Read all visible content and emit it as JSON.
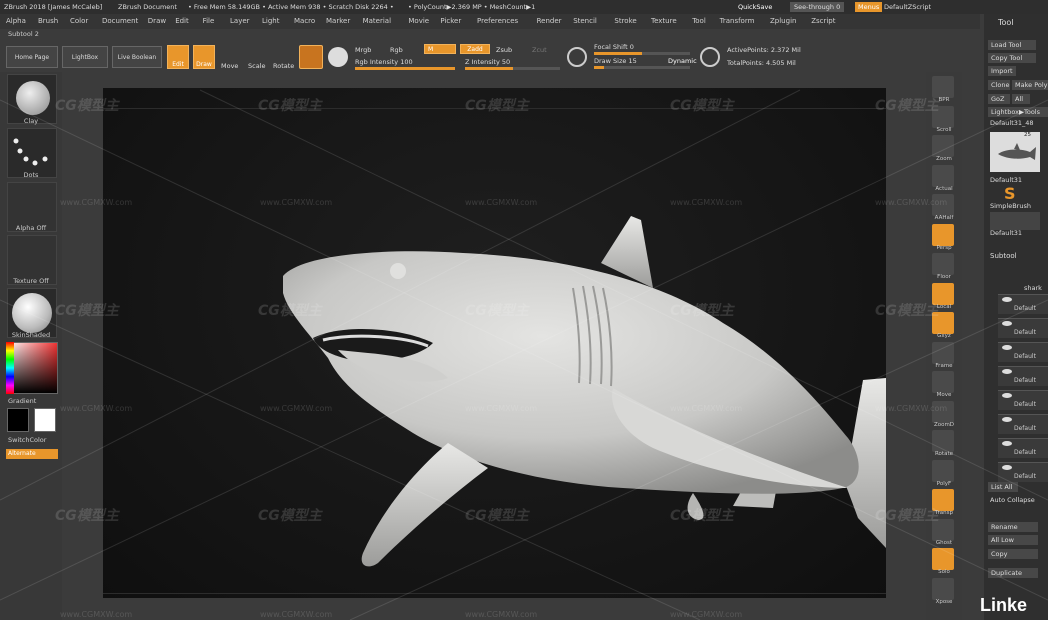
{
  "titlebar": {
    "app": "ZBrush 2018 [James McCaleb]",
    "doc": "ZBrush Document",
    "mem": "• Free Mem 58.149GB • Active Mem 938 • Scratch Disk 2264 •",
    "poly": "• PolyCount▶2.369 MP • MeshCount▶1",
    "quicksave": "QuickSave",
    "seethrough": "See-through  0",
    "menus": "Menus",
    "script": "DefaultZScript"
  },
  "menu": [
    "Alpha",
    "Brush",
    "Color",
    "Document",
    "Draw",
    "Edit",
    "File",
    "Layer",
    "Light",
    "Macro",
    "Marker",
    "Material",
    "Movie",
    "Picker",
    "Preferences",
    "Render",
    "Stencil",
    "Stroke",
    "Texture",
    "Tool",
    "Transform",
    "Zplugin",
    "Zscript"
  ],
  "subtitle": "Subtool 2",
  "toolbar": {
    "home": "Home Page",
    "lightbox": "LightBox",
    "liveboolean": "Live Boolean",
    "edit": "Edit",
    "draw": "Draw",
    "move": "Move",
    "scale": "Scale",
    "rotate": "Rotate",
    "mrgb": "Mrgb",
    "rgb": "Rgb",
    "m": "M",
    "zadd": "Zadd",
    "zsub": "Zsub",
    "zcut": "Zcut",
    "rgb_intensity": "Rgb Intensity 100",
    "z_intensity": "Z Intensity 50",
    "focal": "Focal Shift 0",
    "drawsize": "Draw Size 15",
    "dynamic": "Dynamic",
    "active_points": "ActivePoints: 2.372 Mil",
    "total_points": "TotalPoints: 4.505 Mil",
    "z_intensity_level": 0.5,
    "focal_level": 0.5,
    "drawsize_level": 0.1
  },
  "left": {
    "clay": "Clay",
    "dots": "Dots",
    "alpha": "Alpha Off",
    "texture": "Texture Off",
    "material": "SkinShaded",
    "gradient": "Gradient",
    "switchcolor": "SwitchColor",
    "alternate": "Alternate"
  },
  "right": [
    "BPR",
    "Scroll",
    "Zoom",
    "Actual",
    "AAHalf",
    "Persp",
    "Floor",
    "Local",
    "Gxyz",
    "Frame",
    "Move",
    "ZoomD",
    "Rotate",
    "PolyF",
    "Transp",
    "Ghost",
    "Solo",
    "Xpose"
  ],
  "tray": {
    "title": "Tool",
    "load": "Load Tool",
    "save": "Save As",
    "copy": "Copy Tool",
    "paste": "Paste Tool",
    "import": "Import",
    "export": "Export",
    "clone": "Clone",
    "make": "Make PolyMesh3D",
    "goz": "GoZ",
    "all": "All",
    "visible": "Visible",
    "lightbox": "Lightbox▶Tools",
    "default31": "Default31_48",
    "tool_count": "25",
    "default31b": "Default31",
    "simplebrush": "SimpleBrush",
    "default31c": "Default31",
    "subtool": "Subtool",
    "shark": "shark",
    "default": "Default",
    "listall": "List All",
    "autocollapse": "Auto Collapse",
    "rename": "Rename",
    "alllow": "All Low",
    "copy2": "Copy",
    "duplicate": "Duplicate"
  },
  "watermark": {
    "logo": "CG模型主",
    "url": "www.CGMXW.com"
  },
  "brand": "Linke"
}
